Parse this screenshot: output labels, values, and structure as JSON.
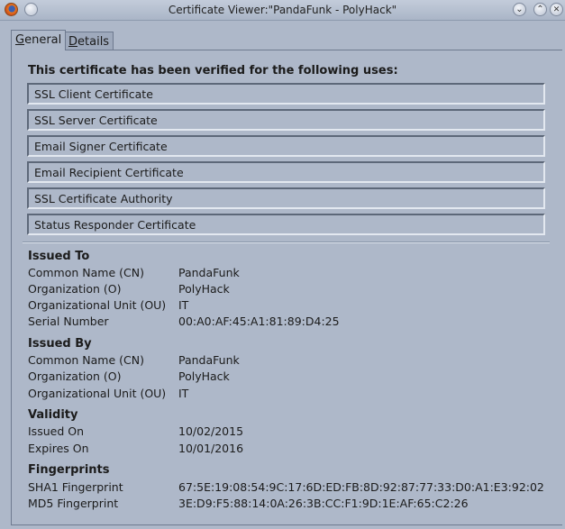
{
  "window": {
    "title": "Certificate Viewer:\"PandaFunk - PolyHack\"",
    "buttons": [
      "minimize",
      "maximize",
      "close"
    ]
  },
  "tabs": [
    {
      "label_mnemonic": "G",
      "label_rest": "eneral",
      "active": true
    },
    {
      "label_mnemonic": "D",
      "label_rest": "etails",
      "active": false
    }
  ],
  "verified": {
    "heading": "This certificate has been verified for the following uses:",
    "uses": [
      "SSL Client Certificate",
      "SSL Server Certificate",
      "Email Signer Certificate",
      "Email Recipient Certificate",
      "SSL Certificate Authority",
      "Status Responder Certificate"
    ]
  },
  "issued_to": {
    "title": "Issued To",
    "rows": [
      {
        "label": "Common Name (CN)",
        "value": "PandaFunk"
      },
      {
        "label": "Organization (O)",
        "value": "PolyHack"
      },
      {
        "label": "Organizational Unit (OU)",
        "value": "IT"
      },
      {
        "label": "Serial Number",
        "value": "00:A0:AF:45:A1:81:89:D4:25"
      }
    ]
  },
  "issued_by": {
    "title": "Issued By",
    "rows": [
      {
        "label": "Common Name (CN)",
        "value": "PandaFunk"
      },
      {
        "label": "Organization (O)",
        "value": "PolyHack"
      },
      {
        "label": "Organizational Unit (OU)",
        "value": "IT"
      }
    ]
  },
  "validity": {
    "title": "Validity",
    "rows": [
      {
        "label": "Issued On",
        "value": "10/02/2015"
      },
      {
        "label": "Expires On",
        "value": "10/01/2016"
      }
    ]
  },
  "fingerprints": {
    "title": "Fingerprints",
    "rows": [
      {
        "label": "SHA1 Fingerprint",
        "value": "67:5E:19:08:54:9C:17:6D:ED:FB:8D:92:87:77:33:D0:A1:E3:92:02"
      },
      {
        "label": "MD5 Fingerprint",
        "value": "3E:D9:F5:88:14:0A:26:3B:CC:F1:9D:1E:AF:65:C2:26"
      }
    ]
  }
}
